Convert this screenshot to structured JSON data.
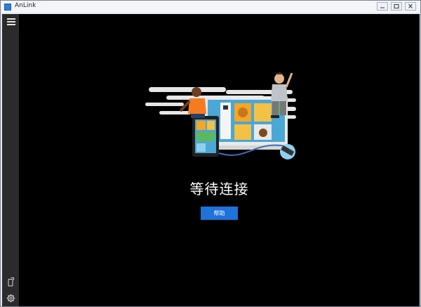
{
  "window": {
    "title": "AnLink",
    "icon": "app-icon"
  },
  "sidebar": {
    "menu_icon": "hamburger-icon",
    "bottom_items": [
      {
        "icon": "phone-connect-icon"
      },
      {
        "icon": "gear-icon"
      }
    ]
  },
  "main": {
    "illustration": "people-devices-illustration",
    "status_text": "等待连接",
    "help_button_label": "帮助"
  },
  "colors": {
    "accent": "#1e72d9",
    "content_bg": "#000000",
    "sidebar_bg": "#2b2b2b"
  }
}
